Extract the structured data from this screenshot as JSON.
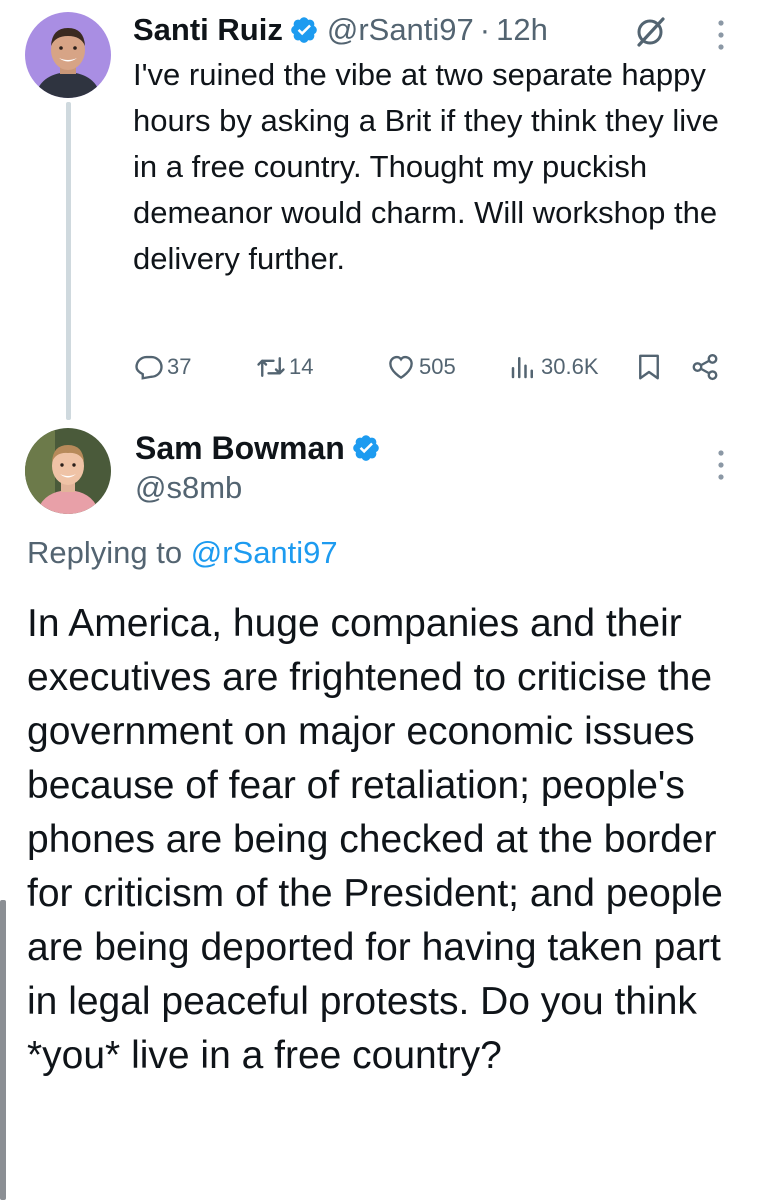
{
  "tweet1": {
    "name": "Santi Ruiz",
    "handle": "@rSanti97",
    "separator": "·",
    "time": "12h",
    "text": "I've ruined the vibe at two separate happy hours by asking a Brit if they think they live in a free country. Thought my puckish demeanor would charm. Will workshop the delivery further.",
    "stats": {
      "replies": "37",
      "retweets": "14",
      "likes": "505",
      "views": "30.6K"
    }
  },
  "tweet2": {
    "name": "Sam Bowman",
    "handle": "@s8mb",
    "replying_prefix": "Replying to ",
    "replying_handle": "@rSanti97",
    "text": "In America, huge companies and their executives are frightened to criticise the government on major economic issues because of fear of retaliation; people's phones are being checked at the border for criticism of the President; and people are being deported for having taken part in legal peaceful protests. Do you think *you* live in a free country?"
  },
  "colors": {
    "text": "#0f1419",
    "secondary": "#536471",
    "accent": "#1d9bf0",
    "thread_line": "#cfd9de"
  },
  "icons": [
    "verified-badge-icon",
    "grok-icon",
    "more-icon",
    "reply-icon",
    "retweet-icon",
    "like-icon",
    "views-icon",
    "bookmark-icon",
    "share-icon"
  ]
}
